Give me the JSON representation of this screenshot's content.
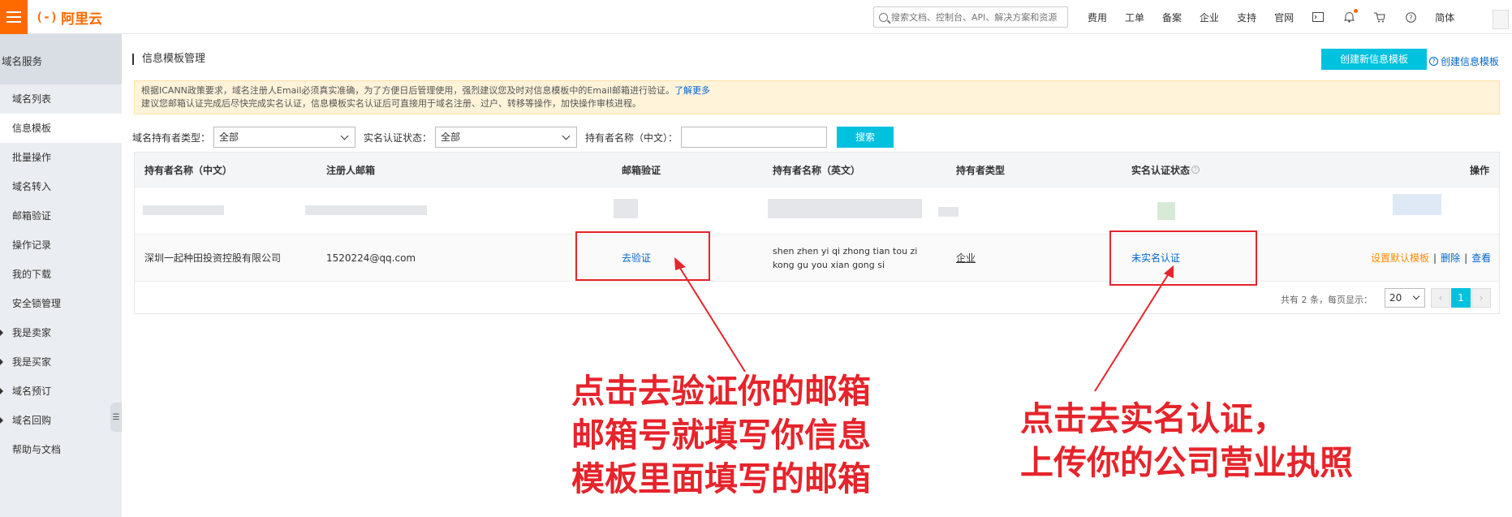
{
  "topbar": {
    "logo_mark": "(-)",
    "logo_text": "阿里云",
    "search_placeholder": "搜索文档、控制台、API、解决方案和资源",
    "nav": [
      "费用",
      "工单",
      "备案",
      "企业",
      "支持",
      "官网"
    ],
    "lang": "简体",
    "icons": [
      "terminal-icon",
      "bell-icon",
      "cart-icon",
      "help-icon"
    ]
  },
  "sidebar": {
    "title": "域名服务",
    "items": [
      {
        "label": "域名列表",
        "caret": false
      },
      {
        "label": "信息模板",
        "caret": false,
        "active": true
      },
      {
        "label": "批量操作",
        "caret": false
      },
      {
        "label": "域名转入",
        "caret": false
      },
      {
        "label": "邮箱验证",
        "caret": false
      },
      {
        "label": "操作记录",
        "caret": false
      },
      {
        "label": "我的下载",
        "caret": false
      },
      {
        "label": "安全锁管理",
        "caret": false
      },
      {
        "label": "我是卖家",
        "caret": true
      },
      {
        "label": "我是买家",
        "caret": true
      },
      {
        "label": "域名预订",
        "caret": true
      },
      {
        "label": "域名回购",
        "caret": true
      },
      {
        "label": "帮助与文档",
        "caret": false
      }
    ]
  },
  "main": {
    "page_title": "信息模板管理",
    "create_button": "创建新信息模板",
    "create_help": "创建信息模板",
    "notice_line1": "根据ICANN政策要求，域名注册人Email必须真实准确，为了方便日后管理使用，强烈建议您及时对信息模板中的Email邮箱进行验证。",
    "notice_link": "了解更多",
    "notice_line2": "建议您邮箱认证完成后尽快完成实名认证，信息模板实名认证后可直接用于域名注册、过户、转移等操作，加快操作审核进程。",
    "filters": {
      "holder_type_label": "域名持有者类型：",
      "holder_type_value": "全部",
      "realname_label": "实名认证状态：",
      "realname_value": "全部",
      "holder_name_label": "持有者名称（中文）：",
      "holder_name_value": "",
      "search_button": "搜索"
    },
    "table": {
      "headers": [
        "持有者名称（中文）",
        "注册人邮箱",
        "邮箱验证",
        "持有者名称（英文）",
        "持有者类型",
        "实名认证状态",
        "操作"
      ],
      "row": {
        "name_cn": "深圳一起种田投资控股有限公司",
        "email": "1520224@qq.com",
        "email_verify": "去验证",
        "name_en_line1": "shen zhen yi qi zhong tian tou zi",
        "name_en_line2": "kong gu you xian gong si",
        "holder_type": "企业",
        "realname_status": "未实名认证",
        "op_default": "设置默认模板",
        "op_delete": "删除",
        "op_view": "查看",
        "op_sep": "|"
      }
    },
    "pager": {
      "info": "共有 2 条，每页显示：",
      "page_size": "20",
      "prev": "‹",
      "current": "1",
      "next": "›"
    }
  },
  "annotations": {
    "left_line1": "点击去验证你的邮箱",
    "left_line2": "邮箱号就填写你信息",
    "left_line3": "模板里面填写的邮箱",
    "right_line1": "点击去实名认证，",
    "right_line2": "上传你的公司营业执照",
    "color": "#e6242b"
  }
}
